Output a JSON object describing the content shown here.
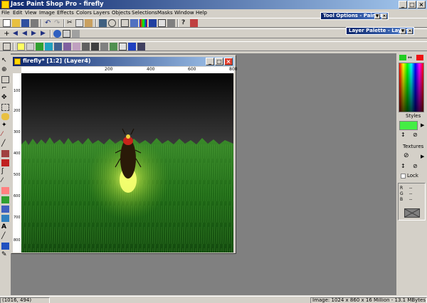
{
  "app": {
    "title": "Jasc Paint Shop Pro - firefly"
  },
  "menus": [
    "File",
    "Edit",
    "View",
    "Image",
    "Effects",
    "Colors",
    "Layers",
    "Objects",
    "Selections",
    "Masks",
    "Window",
    "Help"
  ],
  "palettes": {
    "tool_options": "Tool Options - Paint B",
    "layer_palette": "Layer Palette - Layer"
  },
  "image_window": {
    "title": "firefly* [1:2] (Layer4)"
  },
  "ruler": {
    "top_ticks": [
      "200",
      "400",
      "600",
      "800"
    ],
    "left_ticks": [
      "100",
      "200",
      "300",
      "400",
      "500",
      "600",
      "700",
      "800"
    ]
  },
  "right_panel": {
    "styles_label": "Styles",
    "textures_label": "Textures",
    "lock_label": "Lock",
    "info_rows": [
      {
        "label": "R",
        "value": "--"
      },
      {
        "label": "G",
        "value": "--"
      },
      {
        "label": "B",
        "value": "--"
      }
    ],
    "fg_color": "#22cc22",
    "bg_color": "#ee1111",
    "style_swatch_color": "#44ee44"
  },
  "status": {
    "coords": "(1016, 494)",
    "image_info": "Image:  1024 x 860 x 16 Million - 13.1 MBytes"
  }
}
